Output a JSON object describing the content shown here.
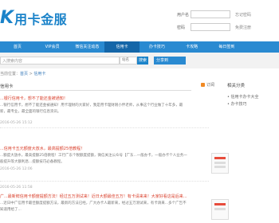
{
  "logo": {
    "k": "K",
    "text": "用卡金服"
  },
  "login": {
    "user_label": "用户名",
    "pass_label": "密码",
    "link1": "忘记密码",
    "link2": "免费注册"
  },
  "nav": [
    "首页",
    "VIP会员",
    "微信关注动态",
    "信用卡",
    "办卡技巧",
    "卡攻略",
    "每日签到",
    ""
  ],
  "search": {
    "placeholder": "入搜索内容",
    "select": "站名",
    "button": "搜索",
    "share": "分享到"
  },
  "breadcrumb": {
    "prefix": "当前位置：",
    "home": "首页",
    "sep": " > ",
    "current": "信用卡"
  },
  "main_title": "信用卡",
  "subscribe": "订阅",
  "sidebar": {
    "title": "相关分类",
    "items": [
      "• 信用卡办卡大全",
      "• 办卡技巧"
    ]
  },
  "articles": [
    {
      "title": "...银行信用卡，想不了能还金被通知！",
      "meta": "2016-05-26 15:12",
      "body": "...银行信用卡，想不了能还金被通知！用卡理财的大家好，我是用卡理财刚小伴老师，从事这个行业做了十年多，最新，最专业，最全面的银行信息资讯。"
    },
    {
      "title": "...信用卡五元额度大放水，最高提额25倍教程！",
      "meta": "2016-05-26 12:06",
      "body": "...额度大放水，最高提额25倍教程！工行广东个税额度提额，微信关注公众号【广东...一般办卡，一般办卡个人业务一般提升等大额利息...提额技巧必备教程。"
    },
    {
      "title": "广...最新鲜信用卡额度提额方法！经过五万测试来！近日大额最佳五万！有卡请来来！大家好看这是后来...",
      "meta": "2016-05-26 11:58",
      "body": "...近日中广信用卡最佳额度提额方法，最新的方法已经，广大办卡人最新来，经过五万测试来，有卡请来...多个广告不知道用给了..."
    }
  ],
  "colors": {
    "nav": "#2a8ad1",
    "nav_active": "#1566a8",
    "title": "#d93e2a",
    "brand": "#1b83c9"
  }
}
